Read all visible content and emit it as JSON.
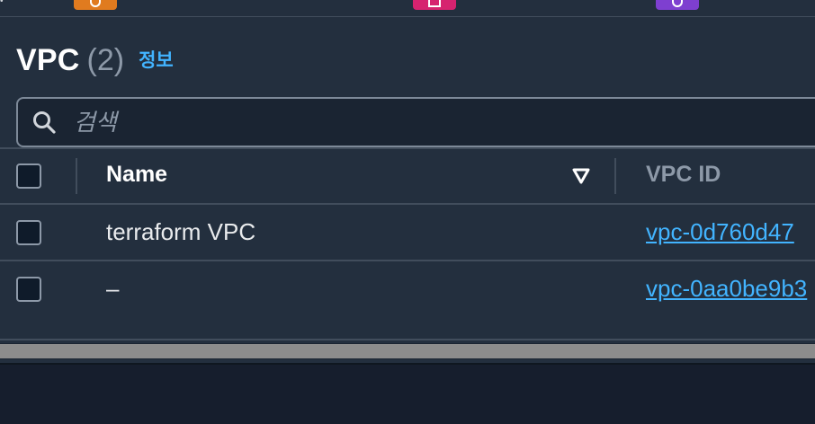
{
  "service_icons": [
    {
      "name": "orange-service-icon",
      "color": "#e07b1f"
    },
    {
      "name": "pink-service-icon",
      "color": "#d6236f"
    },
    {
      "name": "purple-service-icon",
      "color": "#7e3fd0"
    }
  ],
  "header": {
    "title": "VPC",
    "count": "(2)",
    "info_label": "정보"
  },
  "search": {
    "placeholder": "검색",
    "value": ""
  },
  "table": {
    "columns": [
      "Name",
      "VPC ID"
    ],
    "rows": [
      {
        "name": "terraform VPC",
        "vpc_id": "vpc-0d760d47"
      },
      {
        "name": "–",
        "vpc_id": "vpc-0aa0be9b3"
      }
    ]
  },
  "colors": {
    "background": "#232f3e",
    "link": "#42b4ff",
    "border": "#414d5c"
  }
}
